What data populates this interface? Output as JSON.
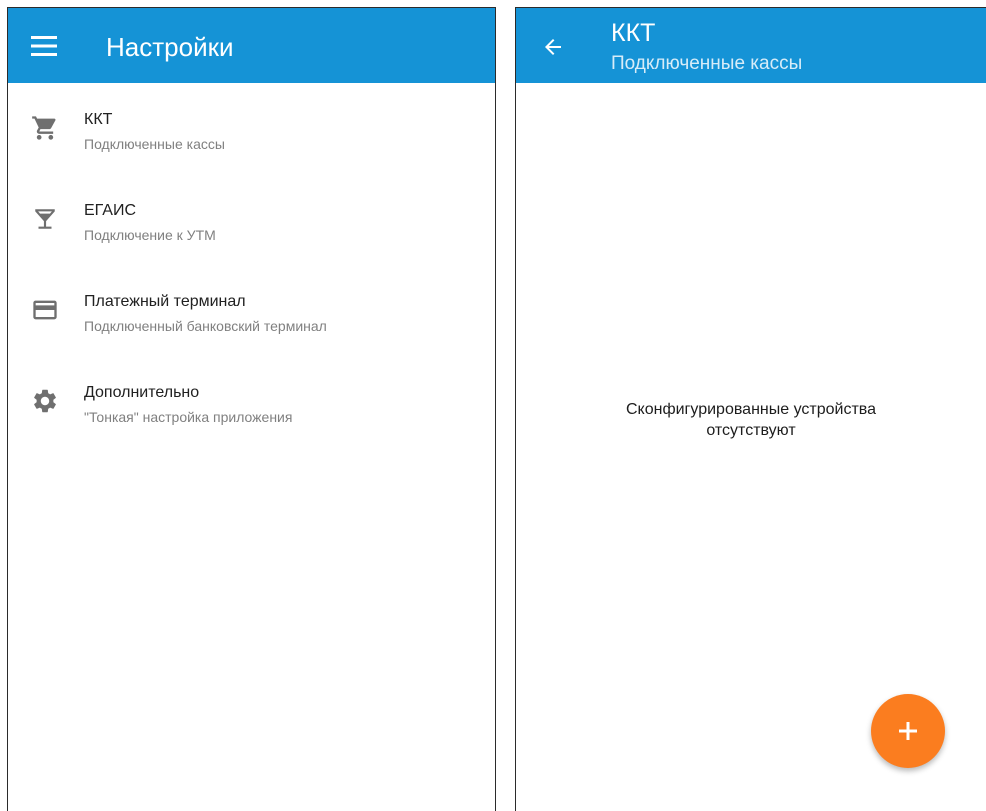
{
  "left_screen": {
    "title": "Настройки",
    "menu_icon": "menu-icon",
    "items": [
      {
        "icon": "cart-icon",
        "title": "ККТ",
        "subtitle": "Подключенные кассы"
      },
      {
        "icon": "cocktail-icon",
        "title": "ЕГАИС",
        "subtitle": "Подключение к УТМ"
      },
      {
        "icon": "credit-card-icon",
        "title": "Платежный терминал",
        "subtitle": "Подключенный банковский терминал"
      },
      {
        "icon": "gear-icon",
        "title": "Дополнительно",
        "subtitle": "\"Тонкая\" настройка приложения"
      }
    ]
  },
  "right_screen": {
    "title": "ККТ",
    "subtitle": "Подключенные кассы",
    "back_icon": "arrow-left-icon",
    "empty_line1": "Сконфигурированные устройства",
    "empty_line2": "отсутствуют",
    "fab_icon": "plus-icon"
  },
  "colors": {
    "appbar": "#1593d6",
    "fab": "#fb7d1f",
    "icon_gray": "#6f6f6f",
    "subtitle_gray": "#808080"
  }
}
